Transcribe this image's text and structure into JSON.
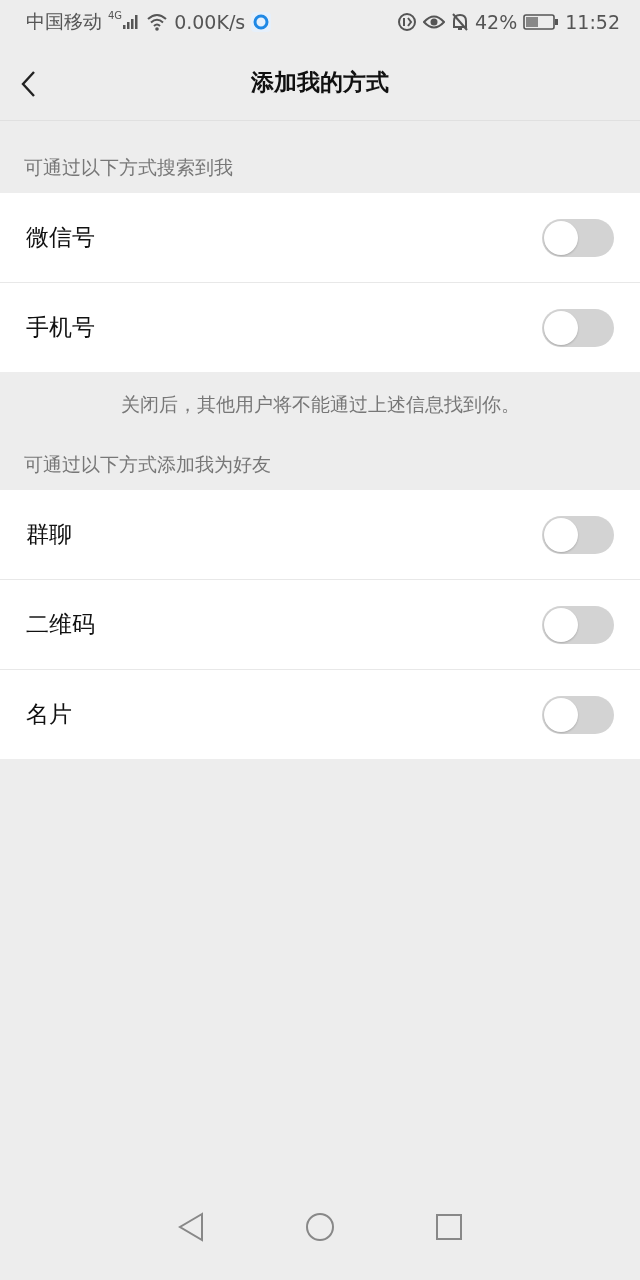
{
  "status_bar": {
    "carrier": "中国移动",
    "network": "4G",
    "speed": "0.00K/s",
    "battery": "42%",
    "time": "11:52"
  },
  "nav": {
    "title": "添加我的方式"
  },
  "sections": [
    {
      "header": "可通过以下方式搜索到我",
      "items": [
        {
          "label": "微信号",
          "on": false
        },
        {
          "label": "手机号",
          "on": false
        }
      ],
      "note": "关闭后，其他用户将不能通过上述信息找到你。"
    },
    {
      "header": "可通过以下方式添加我为好友",
      "items": [
        {
          "label": "群聊",
          "on": false
        },
        {
          "label": "二维码",
          "on": false
        },
        {
          "label": "名片",
          "on": false
        }
      ]
    }
  ]
}
